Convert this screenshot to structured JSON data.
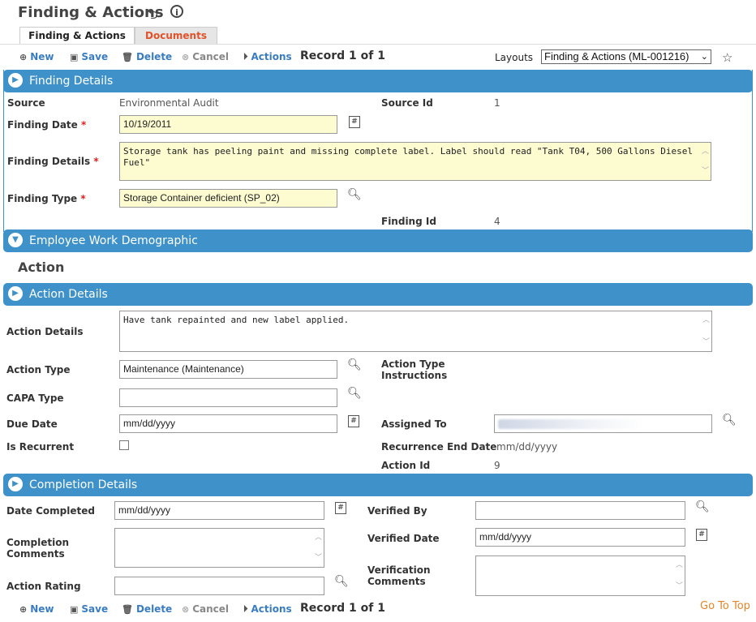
{
  "page": {
    "title": "Finding & Actions",
    "tabs": [
      {
        "label": "Finding & Actions"
      },
      {
        "label": "Documents"
      }
    ]
  },
  "toolbar": {
    "new": "New",
    "save": "Save",
    "delete": "Delete",
    "cancel": "Cancel",
    "actions": "Actions",
    "record": "Record 1 of 1",
    "layouts_label": "Layouts",
    "layouts_value": "Finding & Actions (ML-001216)"
  },
  "finding_details": {
    "header": "Finding Details",
    "source_label": "Source",
    "source_value": "Environmental Audit",
    "source_id_label": "Source Id",
    "source_id_value": "1",
    "finding_date_label": "Finding Date",
    "finding_date_value": "10/19/2011",
    "details_label": "Finding Details",
    "details_value": "Storage tank has peeling paint and missing complete label.  Label should read \"Tank T04, 500 Gallons Diesel Fuel\"",
    "type_label": "Finding Type",
    "type_value": "Storage Container deficient (SP_02)",
    "finding_id_label": "Finding Id",
    "finding_id_value": "4",
    "required_mark": "*"
  },
  "employee_section": {
    "header": "Employee Work Demographic"
  },
  "action_heading": "Action",
  "action_details": {
    "header": "Action Details",
    "details_label": "Action Details",
    "details_value": "Have tank repainted and new label applied.",
    "type_label": "Action Type",
    "type_value": "Maintenance (Maintenance)",
    "type_instructions_label_1": "Action Type",
    "type_instructions_label_2": "Instructions",
    "capa_label": "CAPA Type",
    "capa_value": "",
    "due_label": "Due Date",
    "due_value": "mm/dd/yyyy",
    "assigned_label": "Assigned To",
    "recurrent_label": "Is Recurrent",
    "recurrence_end_label": "Recurrence End Date",
    "recurrence_end_value": "mm/dd/yyyy",
    "action_id_label": "Action Id",
    "action_id_value": "9"
  },
  "completion_details": {
    "header": "Completion Details",
    "date_completed_label": "Date Completed",
    "date_completed_value": "mm/dd/yyyy",
    "comments_label_1": "Completion",
    "comments_label_2": "Comments",
    "rating_label": "Action Rating",
    "verified_by_label": "Verified By",
    "verified_date_label": "Verified Date",
    "verified_date_value": "mm/dd/yyyy",
    "verification_label_1": "Verification",
    "verification_label_2": "Comments"
  },
  "footer": {
    "go_to_top": "Go To Top"
  },
  "colors": {
    "section_bar": "#3e91c9",
    "link": "#3a7cc0",
    "required_field_bg": "#fdfbd0"
  },
  "icons": [
    "undo-icon",
    "info-icon",
    "plus-icon",
    "save-icon",
    "trash-icon",
    "cancel-icon",
    "play-icon",
    "pin-icon",
    "calendar-icon",
    "search-icon",
    "expand-icon",
    "collapse-icon"
  ]
}
